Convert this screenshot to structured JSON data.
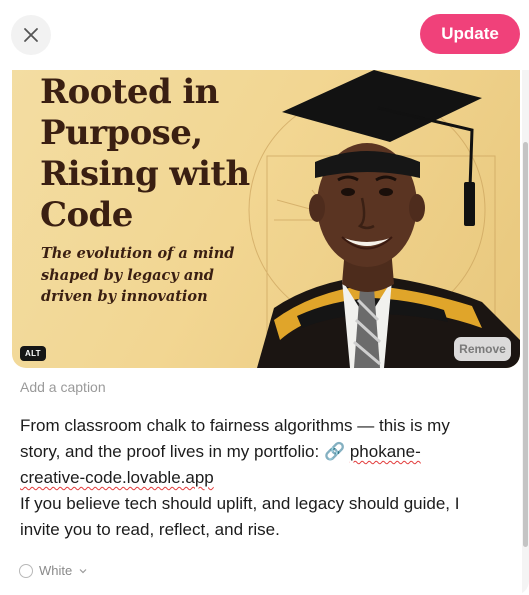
{
  "toolbar": {
    "close_icon": "close-icon",
    "update_label": "Update",
    "accent_color": "#f0417a"
  },
  "media": {
    "headline_lines": [
      "Rooted in",
      "Purpose,",
      "Rising with",
      "Code"
    ],
    "subheadline_lines": [
      "The evolution of a mind",
      "shaped by legacy and",
      "driven by innovation"
    ],
    "alt_badge": "ALT",
    "remove_label": "Remove"
  },
  "caption": {
    "placeholder": "Add a caption"
  },
  "post": {
    "line1": "From classroom chalk to fairness algorithms — this is my",
    "line2_text": "story, and the proof lives in my portfolio: ",
    "link_icon": "🔗",
    "link_part1": "phokane-",
    "link_part2": "creative-code.lovable.app",
    "line4": "If you believe tech should uplift, and legacy should guide, I",
    "line5": "invite you to read, reflect, and rise."
  },
  "background_select": {
    "selected": "White"
  }
}
